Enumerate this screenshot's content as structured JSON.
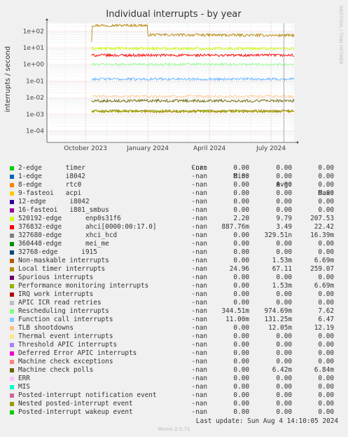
{
  "chart_data": {
    "type": "line",
    "title": "Individual interrupts - by year",
    "ylabel": "interrupts / second",
    "watermark": "RRDTOOL / TOBI OETIKER",
    "y_scale": "log",
    "ylim": [
      2e-05,
      300
    ],
    "y_ticks": [
      {
        "value": 100,
        "label": "1e+02"
      },
      {
        "value": 10,
        "label": "1e+01"
      },
      {
        "value": 1,
        "label": "1e+00"
      },
      {
        "value": 0.1,
        "label": "1e-01"
      },
      {
        "value": 0.01,
        "label": "1e-02"
      },
      {
        "value": 0.001,
        "label": "1e-03"
      },
      {
        "value": 0.0001,
        "label": "1e-04"
      }
    ],
    "xlim": [
      "2023-08-05",
      "2024-08-04"
    ],
    "x_ticks": [
      {
        "date": "2023-10-01",
        "label": "October 2023"
      },
      {
        "date": "2024-01-01",
        "label": "January 2024"
      },
      {
        "date": "2024-04-01",
        "label": "April 2024"
      },
      {
        "date": "2024-07-01",
        "label": "July 2024"
      }
    ],
    "now_marker": "2024-07-20",
    "series": [
      {
        "name": "Local timer interrupts",
        "color": "#b8860b",
        "points": [
          [
            "2023-10-10",
            24.96
          ],
          [
            "2023-10-11",
            220
          ],
          [
            "2023-12-31",
            220
          ],
          [
            "2024-01-01",
            60
          ],
          [
            "2024-08-04",
            55
          ]
        ]
      },
      {
        "name": "520192-edge enp0s31f6",
        "color": "#ccff00",
        "points": [
          [
            "2023-10-10",
            9
          ],
          [
            "2024-08-04",
            9
          ]
        ]
      },
      {
        "name": "376832-edge ahci[0000:00:17.0]",
        "color": "#ff0000",
        "points": [
          [
            "2023-10-10",
            3.5
          ],
          [
            "2024-08-04",
            3.5
          ]
        ]
      },
      {
        "name": "Rescheduling interrupts",
        "color": "#99ff99",
        "points": [
          [
            "2023-10-10",
            1
          ],
          [
            "2024-08-04",
            1
          ]
        ]
      },
      {
        "name": "Function call interrupts",
        "color": "#66b3ff",
        "points": [
          [
            "2023-10-10",
            0.13
          ],
          [
            "2024-08-04",
            0.13
          ]
        ]
      },
      {
        "name": "TLB shootdowns",
        "color": "#ffcc99",
        "points": [
          [
            "2023-10-10",
            0.012
          ],
          [
            "2024-08-04",
            0.012
          ]
        ]
      },
      {
        "name": "Non-maskable interrupts",
        "color": "#b35900",
        "points": [
          [
            "2023-10-10",
            0.0015
          ],
          [
            "2024-08-04",
            0.0015
          ]
        ]
      },
      {
        "name": "Machine check polls",
        "color": "#666600",
        "points": [
          [
            "2023-10-10",
            0.0064
          ],
          [
            "2024-08-04",
            0.0064
          ]
        ]
      },
      {
        "name": "Performance monitoring interrupts",
        "color": "#8fb300",
        "points": [
          [
            "2023-10-10",
            0.0015
          ],
          [
            "2024-08-04",
            0.0015
          ]
        ]
      }
    ]
  },
  "legend": {
    "headers": {
      "cur": "Cur:",
      "min": "Min:",
      "avg": "Avg:",
      "max": "Max:"
    },
    "rows": [
      {
        "label": "2-edge      timer",
        "color": "#00cc00",
        "cur": "-nan",
        "min": "0.00",
        "avg": "0.00",
        "max": "0.00"
      },
      {
        "label": "1-edge      i8042",
        "color": "#0066b3",
        "cur": "-nan",
        "min": "0.00",
        "avg": "0.00",
        "max": "0.00"
      },
      {
        "label": "8-edge      rtc0",
        "color": "#ff8000",
        "cur": "-nan",
        "min": "0.00",
        "avg": "0.00",
        "max": "0.00"
      },
      {
        "label": "9-fasteoi   acpi",
        "color": "#ffcc00",
        "cur": "-nan",
        "min": "0.00",
        "avg": "0.00",
        "max": "0.00"
      },
      {
        "label": "12-edge      i8042",
        "color": "#330099",
        "cur": "-nan",
        "min": "0.00",
        "avg": "0.00",
        "max": "0.00"
      },
      {
        "label": "16-fasteoi   i801_smbus",
        "color": "#990099",
        "cur": "-nan",
        "min": "0.00",
        "avg": "0.00",
        "max": "0.00"
      },
      {
        "label": "520192-edge      enp0s31f6",
        "color": "#ccff00",
        "cur": "-nan",
        "min": "2.20",
        "avg": "9.79",
        "max": "207.53"
      },
      {
        "label": "376832-edge      ahci[0000:00:17.0]",
        "color": "#ff0000",
        "cur": "-nan",
        "min": "887.76m",
        "avg": "3.49",
        "max": "22.42"
      },
      {
        "label": "327680-edge      xhci_hcd",
        "color": "#808080",
        "cur": "-nan",
        "min": "0.00",
        "avg": "329.51n",
        "max": "16.39m"
      },
      {
        "label": "360448-edge      mei_me",
        "color": "#008f00",
        "cur": "-nan",
        "min": "0.00",
        "avg": "0.00",
        "max": "0.00"
      },
      {
        "label": "32768-edge      i915",
        "color": "#00487d",
        "cur": "-nan",
        "min": "0.00",
        "avg": "0.00",
        "max": "0.00"
      },
      {
        "label": "Non-maskable interrupts",
        "color": "#b35a00",
        "cur": "-nan",
        "min": "0.00",
        "avg": "1.53m",
        "max": "6.69m"
      },
      {
        "label": "Local timer interrupts",
        "color": "#b38f00",
        "cur": "-nan",
        "min": "24.96",
        "avg": "67.11",
        "max": "259.07"
      },
      {
        "label": "Spurious interrupts",
        "color": "#6b006b",
        "cur": "-nan",
        "min": "0.00",
        "avg": "0.00",
        "max": "0.00"
      },
      {
        "label": "Performance monitoring interrupts",
        "color": "#8fb300",
        "cur": "-nan",
        "min": "0.00",
        "avg": "1.53m",
        "max": "6.69m"
      },
      {
        "label": "IRQ work interrupts",
        "color": "#b30000",
        "cur": "-nan",
        "min": "0.00",
        "avg": "0.00",
        "max": "0.00"
      },
      {
        "label": "APIC ICR read retries",
        "color": "#bebebe",
        "cur": "-nan",
        "min": "0.00",
        "avg": "0.00",
        "max": "0.00"
      },
      {
        "label": "Rescheduling interrupts",
        "color": "#80ff80",
        "cur": "-nan",
        "min": "344.51m",
        "avg": "974.69m",
        "max": "7.62"
      },
      {
        "label": "Function call interrupts",
        "color": "#80c9ff",
        "cur": "-nan",
        "min": "11.00m",
        "avg": "131.25m",
        "max": "6.47"
      },
      {
        "label": "TLB shootdowns",
        "color": "#ffc080",
        "cur": "-nan",
        "min": "0.00",
        "avg": "12.05m",
        "max": "12.19"
      },
      {
        "label": "Thermal event interrupts",
        "color": "#ffe680",
        "cur": "-nan",
        "min": "0.00",
        "avg": "0.00",
        "max": "0.00"
      },
      {
        "label": "Threshold APIC interrupts",
        "color": "#aa80ff",
        "cur": "-nan",
        "min": "0.00",
        "avg": "0.00",
        "max": "0.00"
      },
      {
        "label": "Deferred Error APIC interrupts",
        "color": "#ee00cc",
        "cur": "-nan",
        "min": "0.00",
        "avg": "0.00",
        "max": "0.00"
      },
      {
        "label": "Machine check exceptions",
        "color": "#ff8080",
        "cur": "-nan",
        "min": "0.00",
        "avg": "0.00",
        "max": "0.00"
      },
      {
        "label": "Machine check polls",
        "color": "#666600",
        "cur": "-nan",
        "min": "0.00",
        "avg": "6.42m",
        "max": "6.84m"
      },
      {
        "label": "ERR",
        "color": "#ffbfff",
        "cur": "-nan",
        "min": "0.00",
        "avg": "0.00",
        "max": "0.00"
      },
      {
        "label": "MIS",
        "color": "#00ffcc",
        "cur": "-nan",
        "min": "0.00",
        "avg": "0.00",
        "max": "0.00"
      },
      {
        "label": "Posted-interrupt notification event",
        "color": "#cc6699",
        "cur": "-nan",
        "min": "0.00",
        "avg": "0.00",
        "max": "0.00"
      },
      {
        "label": "Nested posted-interrupt event",
        "color": "#999900",
        "cur": "-nan",
        "min": "0.00",
        "avg": "0.00",
        "max": "0.00"
      },
      {
        "label": "Posted-interrupt wakeup event",
        "color": "#00cc00",
        "cur": "-nan",
        "min": "0.00",
        "avg": "0.00",
        "max": "0.00"
      }
    ]
  },
  "footer": {
    "last_update": "Last update: Sun Aug  4 14:10:05 2024",
    "munin": "Munin 2.0.73"
  }
}
